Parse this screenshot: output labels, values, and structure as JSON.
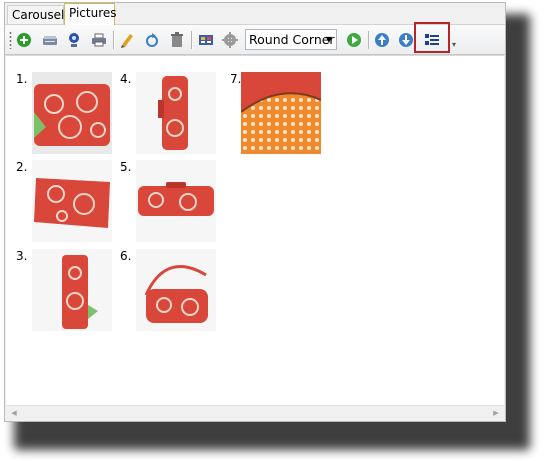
{
  "tabs": [
    {
      "label": "Carousel",
      "active": false
    },
    {
      "label": "Pictures",
      "active": true
    }
  ],
  "toolbar": {
    "buttons": [
      {
        "name": "add-icon",
        "color": "#2d9b2d"
      },
      {
        "name": "scan-icon",
        "color": "#5b6b8a"
      },
      {
        "name": "webcam-icon",
        "color": "#2a52a8"
      },
      {
        "name": "print-icon",
        "color": "#6f7b8e"
      },
      {
        "name": "edit-icon",
        "color": "#e0a020"
      },
      {
        "name": "rotate-icon",
        "color": "#3b7ec6"
      },
      {
        "name": "delete-icon",
        "color": "#8a8a8a"
      },
      {
        "name": "frame-icon",
        "color": "#3a5fa8"
      },
      {
        "name": "settings-icon",
        "color": "#9a9a9a"
      }
    ],
    "corner_style": "Round Corner",
    "after_combo": [
      {
        "name": "play-icon",
        "color": "#3fa93f"
      },
      {
        "name": "move-up-icon",
        "color": "#3b7ec6"
      },
      {
        "name": "move-down-icon",
        "color": "#3b7ec6"
      },
      {
        "name": "properties-icon",
        "color": "#1f3f8a"
      }
    ],
    "highlight_color": "#b5262a"
  },
  "pictures": [
    {
      "label": "1.",
      "view": "front-flat",
      "selected": true
    },
    {
      "label": "2.",
      "view": "bottom"
    },
    {
      "label": "3.",
      "view": "side"
    },
    {
      "label": "4.",
      "view": "side-upright"
    },
    {
      "label": "5.",
      "view": "top"
    },
    {
      "label": "6.",
      "view": "with-strap"
    },
    {
      "label": "7.",
      "view": "interior"
    }
  ],
  "colors": {
    "bag_red": "#d9463a",
    "bag_pattern": "#f2d6c8",
    "interior_orange": "#f08a2e",
    "selection_gray": "#d3d3d3"
  }
}
